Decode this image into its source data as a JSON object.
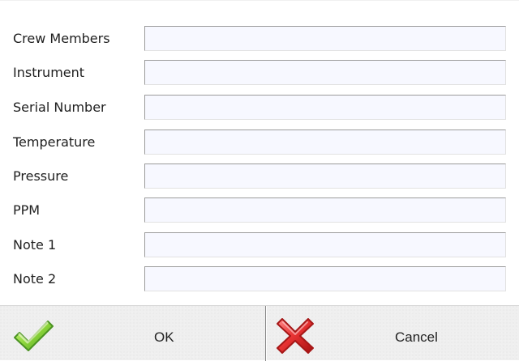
{
  "form": {
    "fields": [
      {
        "label": "Crew Members",
        "value": ""
      },
      {
        "label": "Instrument",
        "value": ""
      },
      {
        "label": "Serial Number",
        "value": ""
      },
      {
        "label": "Temperature",
        "value": ""
      },
      {
        "label": "Pressure",
        "value": ""
      },
      {
        "label": "PPM",
        "value": ""
      },
      {
        "label": "Note 1",
        "value": ""
      },
      {
        "label": "Note 2",
        "value": ""
      }
    ]
  },
  "buttons": {
    "ok_label": "OK",
    "cancel_label": "Cancel",
    "ok_icon": "check-icon",
    "cancel_icon": "x-icon"
  },
  "colors": {
    "input_background": "#f7f8ff",
    "button_bar": "#efefef",
    "ok_icon": "#6ebf28",
    "cancel_icon": "#d92323"
  }
}
